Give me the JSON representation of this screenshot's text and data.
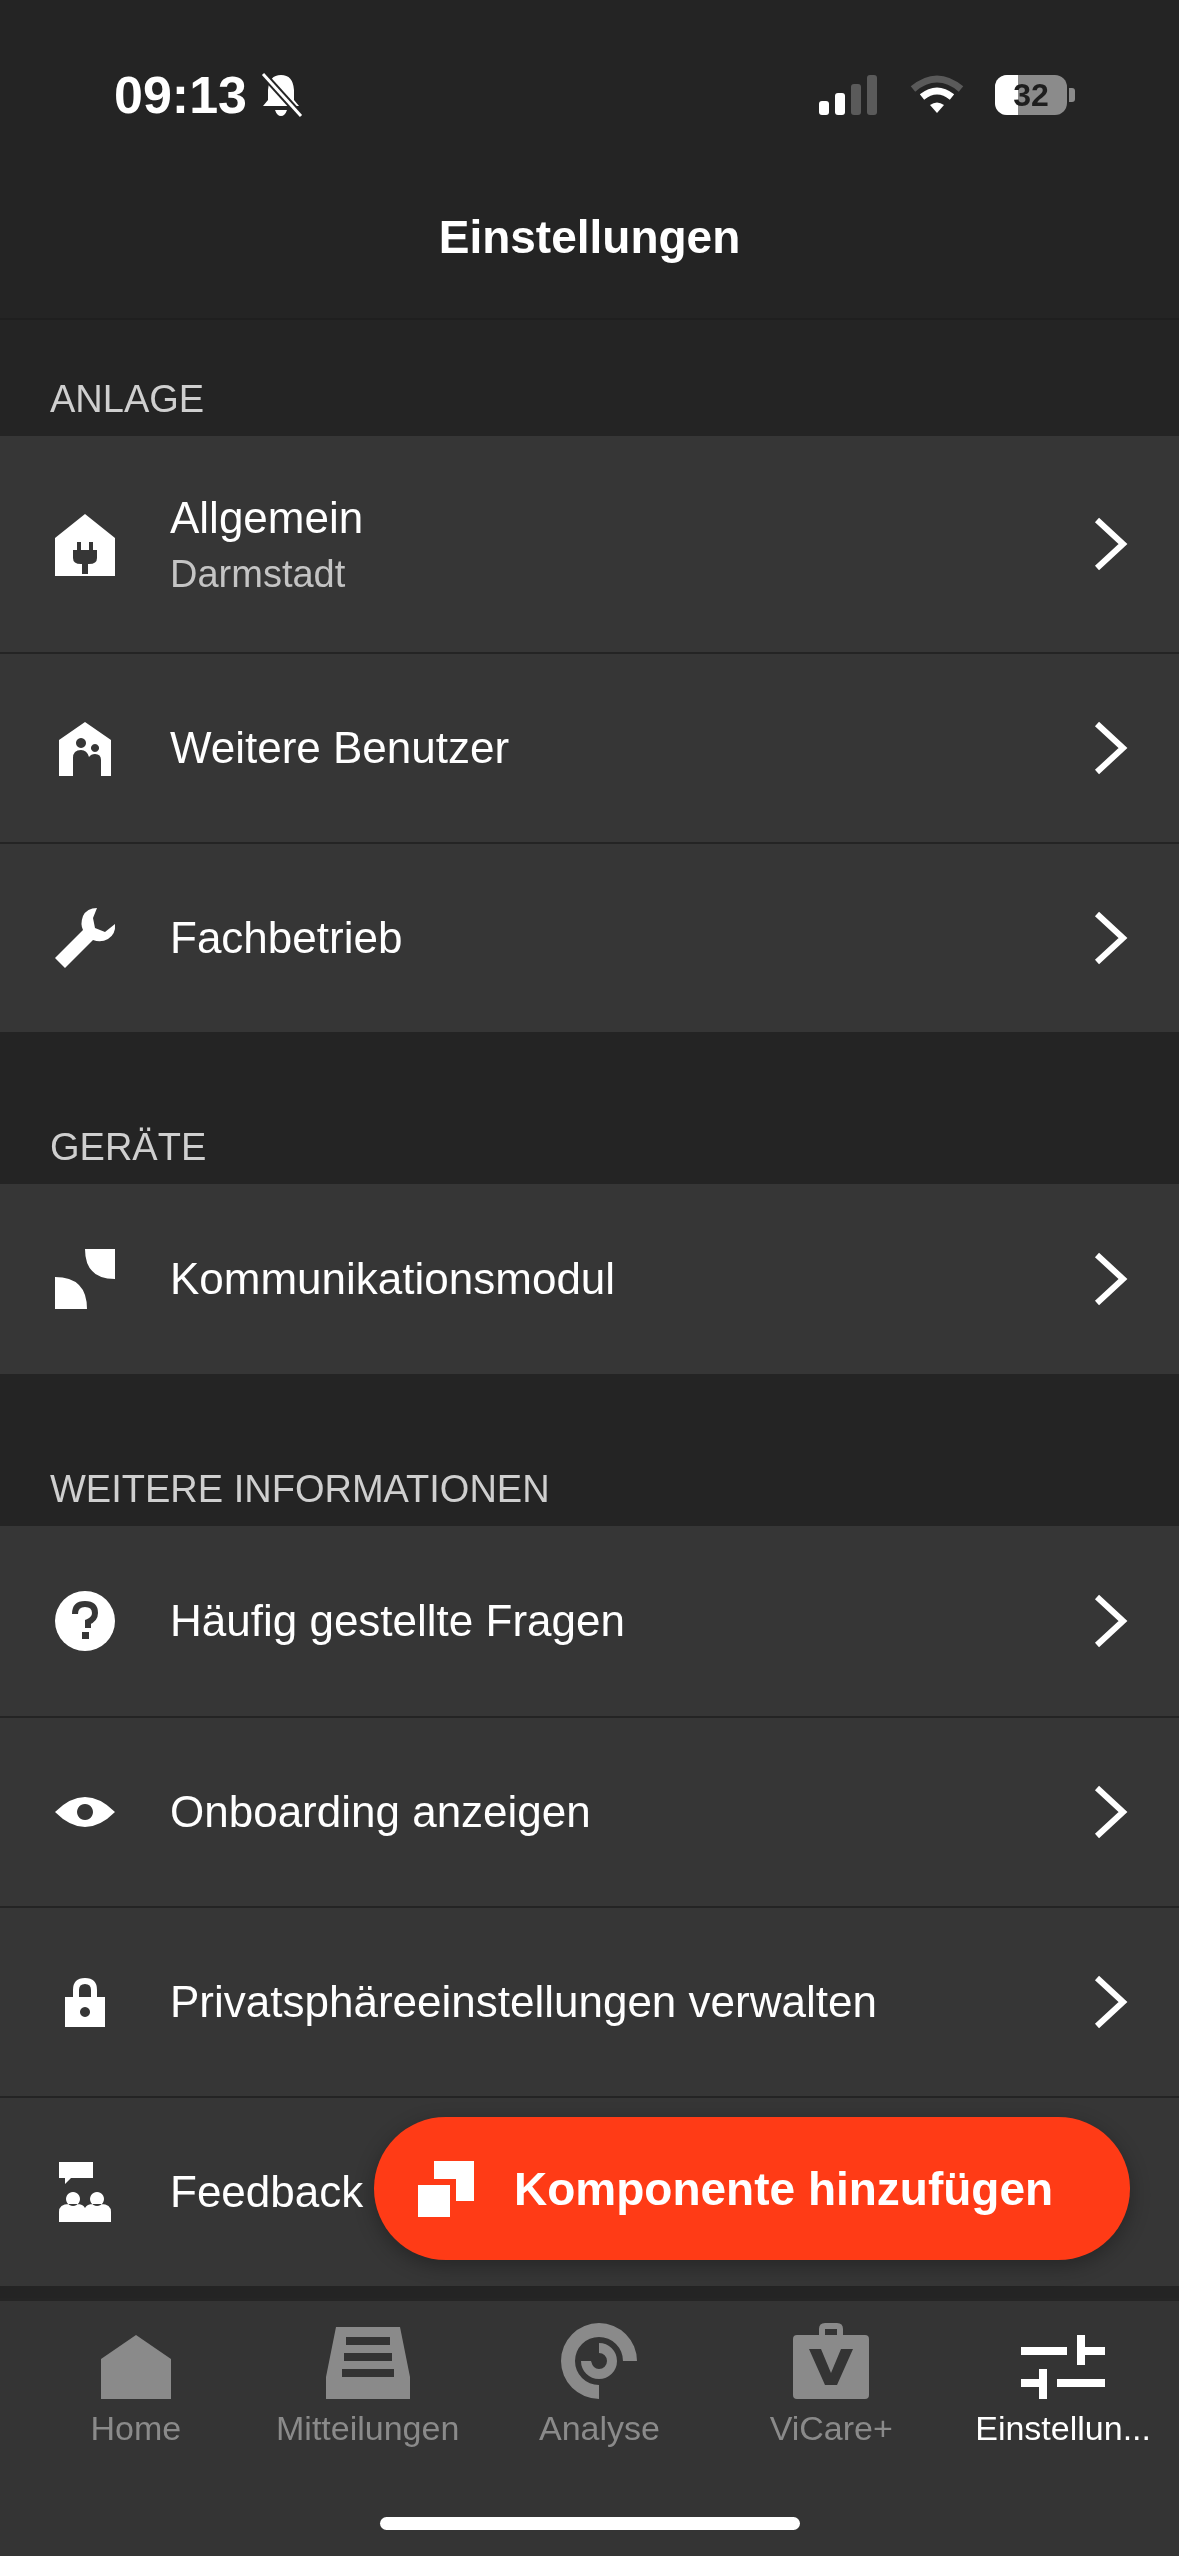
{
  "status_bar": {
    "time": "09:13",
    "battery": "32"
  },
  "header": {
    "title": "Einstellungen"
  },
  "sections": [
    {
      "title": "ANLAGE",
      "items": [
        {
          "label": "Allgemein",
          "subtitle": "Darmstadt"
        },
        {
          "label": "Weitere Benutzer"
        },
        {
          "label": "Fachbetrieb"
        }
      ]
    },
    {
      "title": "GERÄTE",
      "items": [
        {
          "label": "Kommunikationsmodul"
        }
      ]
    },
    {
      "title": "WEITERE INFORMATIONEN",
      "items": [
        {
          "label": "Häufig gestellte Fragen"
        },
        {
          "label": "Onboarding anzeigen"
        },
        {
          "label": "Privatsphäreeinstellungen verwalten"
        },
        {
          "label": "Feedback"
        }
      ]
    }
  ],
  "fab": {
    "label": "Komponente hinzufügen"
  },
  "tabs": [
    {
      "label": "Home",
      "selected": false
    },
    {
      "label": "Mitteilungen",
      "selected": false
    },
    {
      "label": "Analyse",
      "selected": false
    },
    {
      "label": "ViCare+",
      "selected": false
    },
    {
      "label": "Einstellun...",
      "selected": true
    }
  ]
}
